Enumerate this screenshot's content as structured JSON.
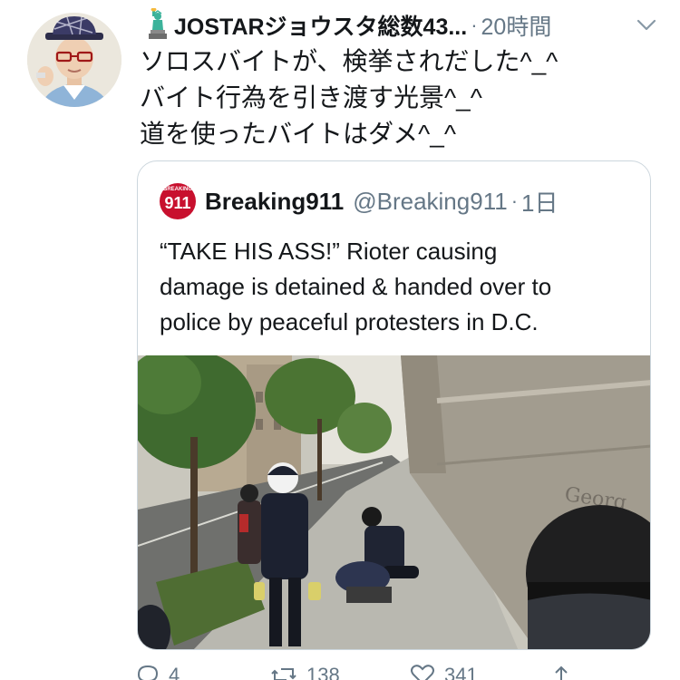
{
  "tweet": {
    "author_name": "JOSTARジョウスタ総数43...",
    "separator": "·",
    "timestamp": "20時間",
    "lines": [
      "ソロスバイトが、検挙されだした^_^",
      "バイト行為を引き渡す光景^_^",
      "道を使ったバイトはダメ^_^"
    ]
  },
  "quote": {
    "logo_text": "911",
    "logo_small": "BREAKING",
    "name": "Breaking911",
    "handle": "@Breaking911",
    "separator": "·",
    "timestamp": "1日",
    "lines": [
      "“TAKE HIS ASS!” Rioter causing",
      "damage is detained & handed over to",
      "police by peaceful protesters in D.C."
    ],
    "media_text": "Georg"
  },
  "actions": {
    "reply_count": "4",
    "retweet_count": "138",
    "like_count": "341"
  },
  "icons": {
    "header": [
      "statue-of-liberty-icon",
      "chevron-down-icon"
    ],
    "actions": [
      "reply-icon",
      "retweet-icon",
      "like-icon",
      "share-icon"
    ]
  },
  "colors": {
    "text": "#14171a",
    "secondary": "#657786",
    "border": "#ccd6dd",
    "brand_red": "#c8102e"
  }
}
